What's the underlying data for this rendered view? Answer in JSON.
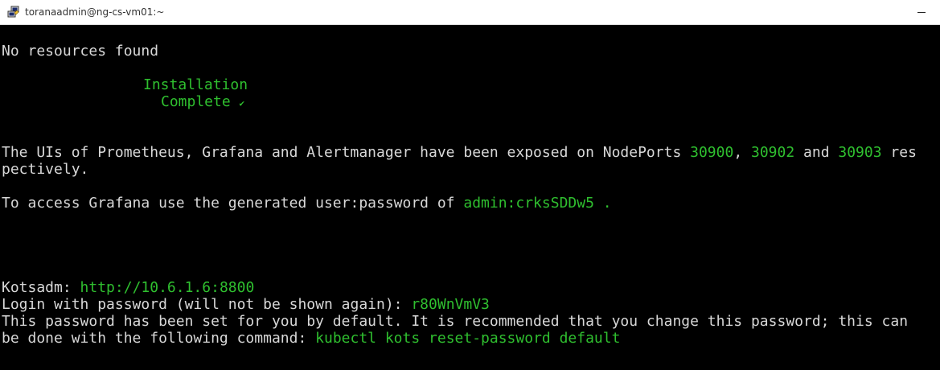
{
  "window": {
    "title": "toranaadmin@ng-cs-vm01:~",
    "app_icon": "putty-icon",
    "minimize_icon": "minimize-icon"
  },
  "colors": {
    "terminal_bg": "#000000",
    "text": "#d8d8d8",
    "highlight": "#2fbf2f"
  },
  "terminal": {
    "no_resources": "No resources found",
    "install_1": "Installation",
    "install_2": "Complete",
    "install_glyph": "✔",
    "exposed_prefix": "The UIs of Prometheus, Grafana and Alertmanager have been exposed on NodePorts ",
    "port_prometheus": "30900",
    "sep_comma": ", ",
    "port_grafana": "30902",
    "sep_and": " and ",
    "port_alertmanager": "30903",
    "exposed_suffix": " res",
    "exposed_wrap": "pectively.",
    "grafana_prefix": "To access Grafana use the generated user:password of ",
    "grafana_credentials": "admin:crksSDDw5 .",
    "kotsadm_label": "Kotsadm: ",
    "kotsadm_url": "http://10.6.1.6:8800",
    "login_label": "Login with password (will not be shown again): ",
    "login_password": "r80WnVmV3",
    "recommend_line": "This password has been set for you by default. It is recommended that you change this password; this can",
    "command_prefix": "be done with the following command: ",
    "command": "kubectl kots reset-password default"
  }
}
